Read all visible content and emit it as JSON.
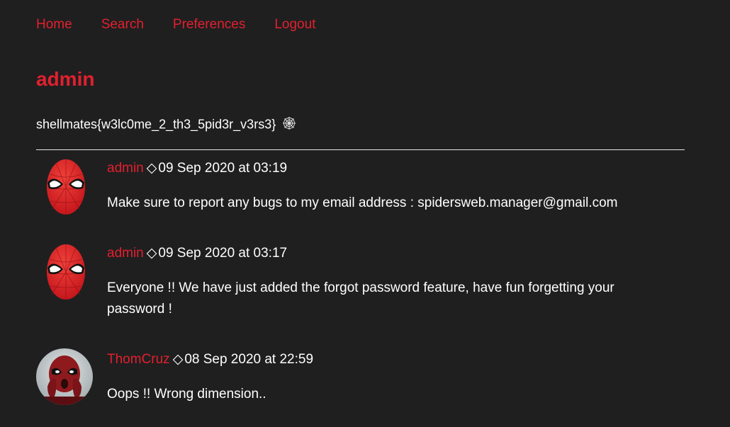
{
  "nav": {
    "home": "Home",
    "search": "Search",
    "preferences": "Preferences",
    "logout": "Logout"
  },
  "profile": {
    "name": "admin",
    "bio": "shellmates{w3lc0me_2_th3_5pid3r_v3rs3}",
    "bio_icon": "spider-web-icon"
  },
  "posts": [
    {
      "author": "admin",
      "separator": "◇",
      "timestamp": "09 Sep 2020 at 03:19",
      "body": "Make sure to report any bugs to my email address : spidersweb.manager@gmail.com",
      "avatar": "spiderman-mask-avatar"
    },
    {
      "author": "admin",
      "separator": "◇",
      "timestamp": "09 Sep 2020 at 03:17",
      "body": "Everyone !! We have just added the forgot password feature, have fun forgetting your password !",
      "avatar": "spiderman-mask-avatar"
    },
    {
      "author": "ThomCruz",
      "separator": "◇",
      "timestamp": "08 Sep 2020 at 22:59",
      "body": "Oops !! Wrong dimension..",
      "avatar": "deadpool-avatar"
    }
  ],
  "colors": {
    "background": "#1f1f20",
    "accent": "#e2202e",
    "text": "#ffffff"
  }
}
